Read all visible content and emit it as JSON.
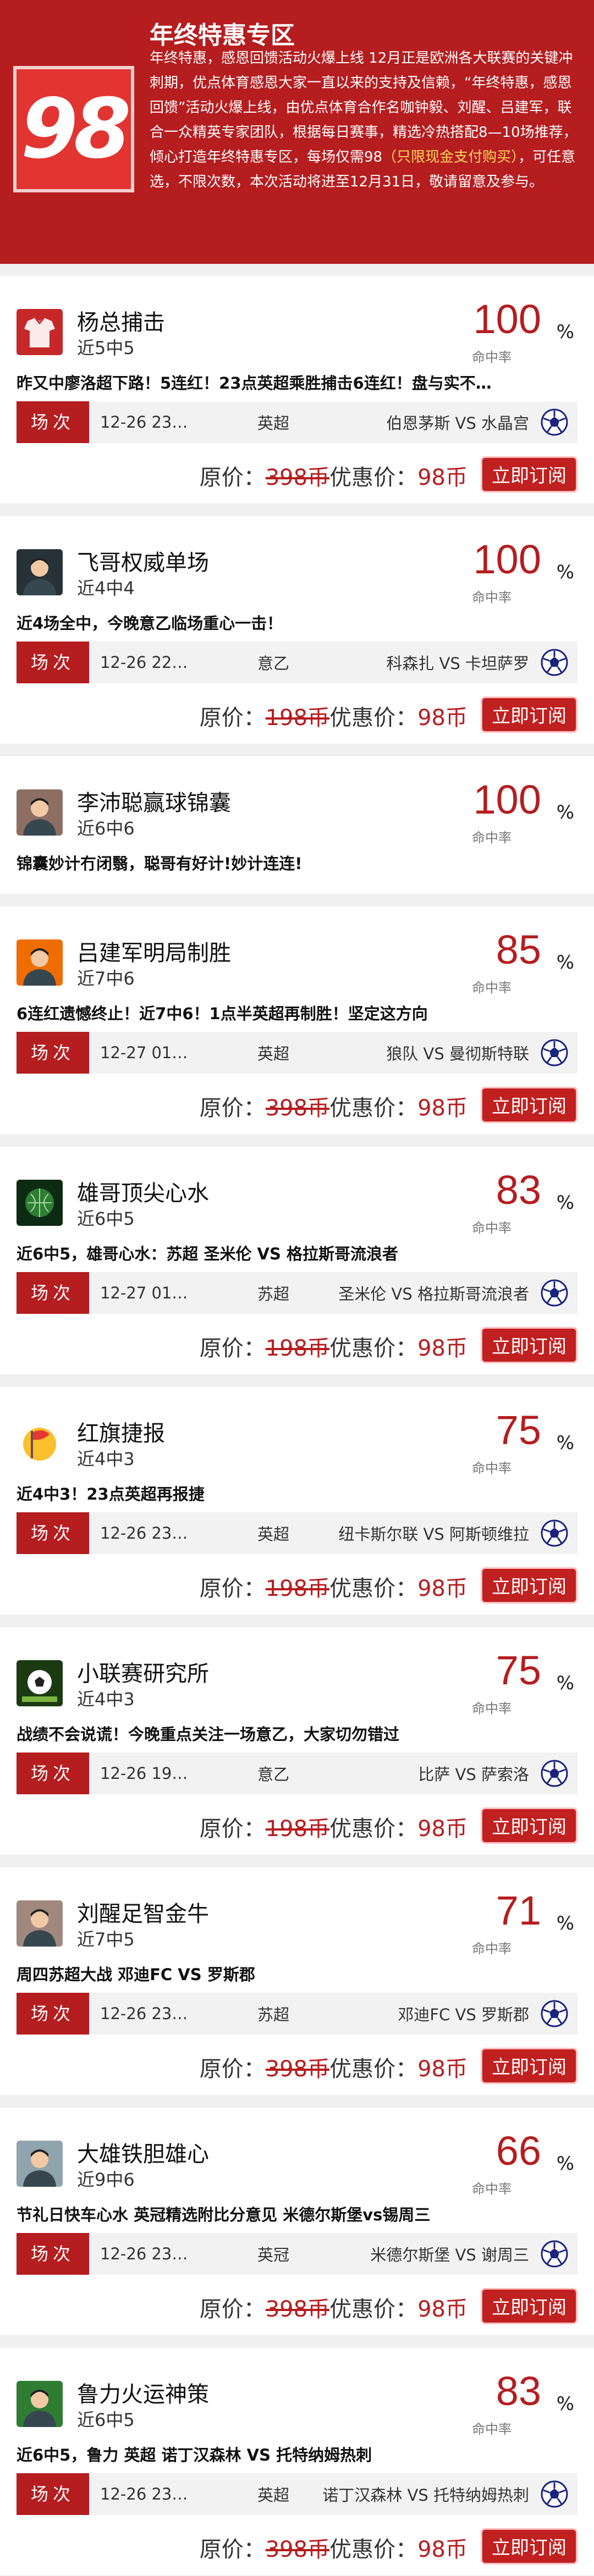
{
  "banner": {
    "badge": "98",
    "title": "年终特惠专区",
    "desc_pre": "年终特惠，感恩回馈活动火爆上线 12月正是欧洲各大联赛的关键冲刺期，优点体育感恩大家一直以来的支持及信赖，“年终特惠，感恩回馈”活动火爆上线，由优点体育合作名咖钟毅、刘醒、吕建军，联合一众精英专家团队，根据每日赛事，精选冷热搭配8—10场推荐，倾心打造年终特惠专区，每场仅需98",
    "desc_highlight": "（只限现金支付购买）",
    "desc_post": "，可任意选，不限次数，本次活动将进至12月31日，敬请留意及参与。"
  },
  "labels": {
    "rate_unit": "%",
    "rate_label": "命中率",
    "match_tag": "场次",
    "price_original_prefix": "原价：",
    "price_now_prefix": "优惠价：",
    "buy": "立即订阅"
  },
  "cards": [
    {
      "name": "杨总捕击",
      "record": "近5中5",
      "rate": "100",
      "highlight": "昨又中廖洛超下路！5连红！23点英超乘胜捕击6连红！盘与实不…",
      "avatar": {
        "color": "#c62828",
        "icon": "jersey"
      },
      "match": {
        "time": "12-26 23…",
        "league": "英超",
        "teams": "伯恩茅斯 VS 水晶宫"
      },
      "price_original": "398币",
      "price_now": "98币"
    },
    {
      "name": "飞哥权威单场",
      "record": "近4中4",
      "rate": "100",
      "highlight": "近4场全中，今晚意乙临场重心一击！",
      "avatar": {
        "color": "#263238",
        "icon": "portrait"
      },
      "match": {
        "time": "12-26 22…",
        "league": "意乙",
        "teams": "科森扎 VS 卡坦萨罗"
      },
      "price_original": "198币",
      "price_now": "98币"
    },
    {
      "name": "李沛聪赢球锦囊",
      "record": "近6中6",
      "rate": "100",
      "highlight": "锦囊妙计冇闭翳，聪哥有好计!妙计连连!",
      "avatar": {
        "color": "#8d6e63",
        "icon": "portrait"
      },
      "match": null,
      "price_original": null,
      "price_now": null
    },
    {
      "name": "吕建军明局制胜",
      "record": "近7中6",
      "rate": "85",
      "highlight": "6连红遗憾终止！近7中6！1点半英超再制胜！坚定这方向",
      "avatar": {
        "color": "#ef6c00",
        "icon": "portrait"
      },
      "match": {
        "time": "12-27 01…",
        "league": "英超",
        "teams": "狼队 VS 曼彻斯特联"
      },
      "price_original": "398币",
      "price_now": "98币"
    },
    {
      "name": "雄哥顶尖心水",
      "record": "近6中5",
      "rate": "83",
      "highlight": "近6中5，雄哥心水：苏超 圣米伦 VS 格拉斯哥流浪者",
      "avatar": {
        "color": "#1b5e20",
        "icon": "globe"
      },
      "match": {
        "time": "12-27 01…",
        "league": "苏超",
        "teams": "圣米伦 VS 格拉斯哥流浪者"
      },
      "price_original": "198币",
      "price_now": "98币"
    },
    {
      "name": "红旗捷报",
      "record": "近4中3",
      "rate": "75",
      "highlight": "近4中3！23点英超再报捷",
      "avatar": {
        "color": "#fbc02d",
        "icon": "flag"
      },
      "match": {
        "time": "12-26 23…",
        "league": "英超",
        "teams": "纽卡斯尔联 VS 阿斯顿维拉"
      },
      "price_original": "198币",
      "price_now": "98币"
    },
    {
      "name": "小联赛研究所",
      "record": "近4中3",
      "rate": "75",
      "highlight": "战绩不会说谎！今晚重点关注一场意乙，大家切勿错过",
      "avatar": {
        "color": "#33691e",
        "icon": "ball"
      },
      "match": {
        "time": "12-26 19…",
        "league": "意乙",
        "teams": "比萨 VS 萨索洛"
      },
      "price_original": "198币",
      "price_now": "98币"
    },
    {
      "name": "刘醒足智金牛",
      "record": "近7中5",
      "rate": "71",
      "highlight": "周四苏超大战 邓迪FC VS 罗斯郡",
      "avatar": {
        "color": "#a1887f",
        "icon": "portrait"
      },
      "match": {
        "time": "12-26 23…",
        "league": "苏超",
        "teams": "邓迪FC VS 罗斯郡"
      },
      "price_original": "398币",
      "price_now": "98币"
    },
    {
      "name": "大雄铁胆雄心",
      "record": "近9中6",
      "rate": "66",
      "highlight": "节礼日快车心水 英冠精选附比分意见 米德尔斯堡vs锡周三",
      "avatar": {
        "color": "#90a4ae",
        "icon": "portrait"
      },
      "match": {
        "time": "12-26 23…",
        "league": "英冠",
        "teams": "米德尔斯堡 VS 谢周三"
      },
      "price_original": "398币",
      "price_now": "98币"
    },
    {
      "name": "鲁力火运神策",
      "record": "近6中5",
      "rate": "83",
      "highlight": "近6中5，鲁力 英超 诺丁汉森林 VS 托特纳姆热刺",
      "avatar": {
        "color": "#2e7d32",
        "icon": "portrait"
      },
      "match": {
        "time": "12-26 23…",
        "league": "英超",
        "teams": "诺丁汉森林 VS 托特纳姆热刺"
      },
      "price_original": "398币",
      "price_now": "98币"
    }
  ]
}
